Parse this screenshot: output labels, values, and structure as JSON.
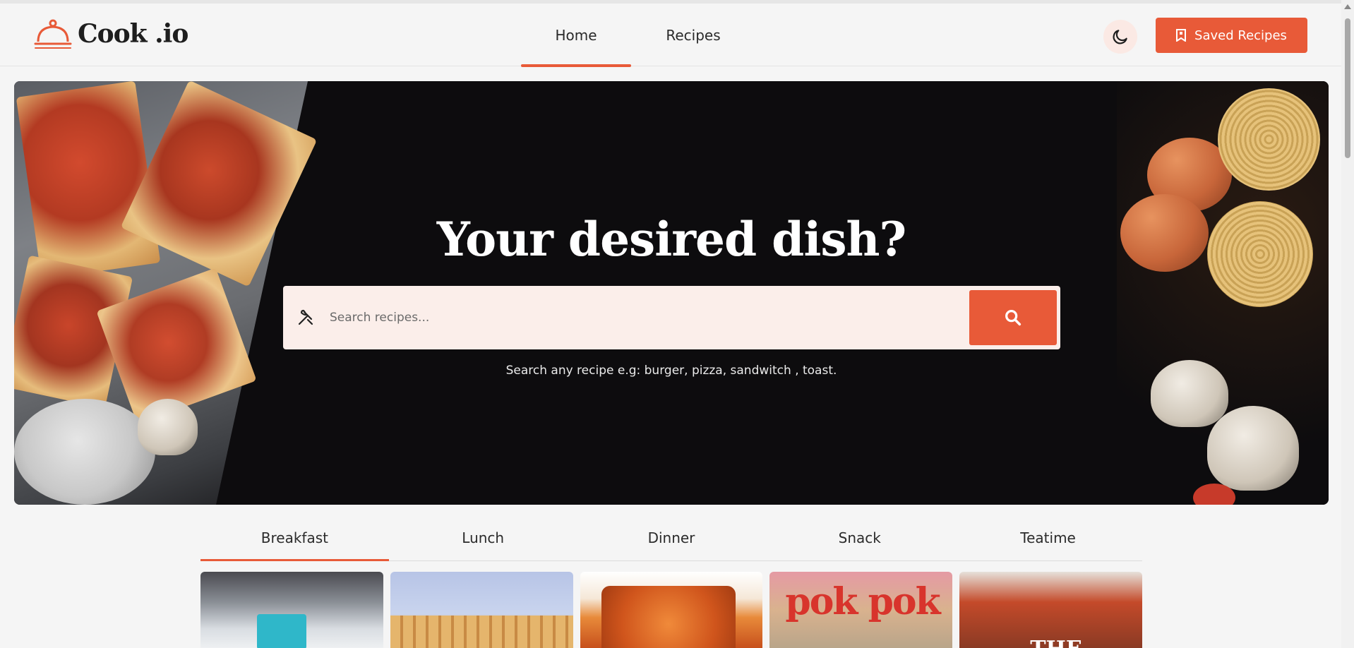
{
  "app": {
    "logo_text": "Cook .io"
  },
  "nav": {
    "items": [
      {
        "label": "Home",
        "active": true
      },
      {
        "label": "Recipes",
        "active": false
      }
    ]
  },
  "header": {
    "theme_toggle_icon": "moon-icon",
    "saved_button_label": "Saved Recipes",
    "saved_button_icon": "bookmark-icon"
  },
  "hero": {
    "title": "Your desired dish?",
    "search_placeholder": "Search recipes...",
    "search_hint": "Search any recipe e.g: burger, pizza, sandwitch , toast."
  },
  "tabs": [
    {
      "label": "Breakfast",
      "active": true
    },
    {
      "label": "Lunch",
      "active": false
    },
    {
      "label": "Dinner",
      "active": false
    },
    {
      "label": "Snack",
      "active": false
    },
    {
      "label": "Teatime",
      "active": false
    }
  ],
  "cards": {
    "card4_text": "pok pok",
    "card5_text": "THE"
  },
  "colors": {
    "accent": "#e85a38",
    "background": "#f5f5f5",
    "hero_dark": "#0d0c0e"
  }
}
